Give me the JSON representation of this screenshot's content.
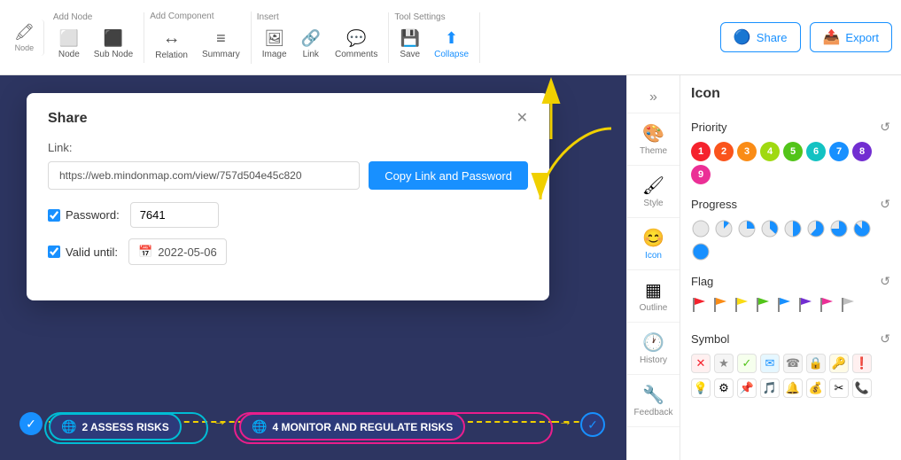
{
  "toolbar": {
    "groups": [
      {
        "label": "Add Node",
        "items": [
          {
            "id": "node",
            "icon": "⬜",
            "label": "Node"
          },
          {
            "id": "subnode",
            "icon": "⬛",
            "label": "Sub Node"
          }
        ]
      },
      {
        "label": "Add Component",
        "items": [
          {
            "id": "relation",
            "icon": "↔",
            "label": "Relation"
          },
          {
            "id": "summary",
            "icon": "📋",
            "label": "Summary"
          }
        ]
      },
      {
        "label": "Insert",
        "items": [
          {
            "id": "image",
            "icon": "🖼",
            "label": "Image"
          },
          {
            "id": "link",
            "icon": "🔗",
            "label": "Link"
          },
          {
            "id": "comments",
            "icon": "💬",
            "label": "Comments"
          }
        ]
      },
      {
        "label": "Tool Settings",
        "items": [
          {
            "id": "save",
            "icon": "💾",
            "label": "Save"
          },
          {
            "id": "collapse",
            "icon": "⬆",
            "label": "Collapse",
            "active": true
          }
        ]
      }
    ],
    "share_label": "Share",
    "export_label": "Export"
  },
  "share_dialog": {
    "title": "Share",
    "link_label": "Link:",
    "link_value": "https://web.mindonmap.com/view/757d504e45c820",
    "copy_button_label": "Copy Link and Password",
    "password_checked": true,
    "password_label": "Password:",
    "password_value": "7641",
    "valid_until_checked": true,
    "valid_until_label": "Valid until:",
    "valid_until_value": "2022-05-06"
  },
  "sidebar": {
    "items": [
      {
        "id": "theme",
        "icon": "🎨",
        "label": "Theme"
      },
      {
        "id": "style",
        "icon": "🖌",
        "label": "Style"
      },
      {
        "id": "icon",
        "icon": "😊",
        "label": "Icon",
        "active": true
      },
      {
        "id": "outline",
        "icon": "▦",
        "label": "Outline"
      },
      {
        "id": "history",
        "icon": "🕐",
        "label": "History"
      },
      {
        "id": "feedback",
        "icon": "🔧",
        "label": "Feedback"
      }
    ]
  },
  "right_panel": {
    "title": "Icon",
    "sections": {
      "priority": {
        "label": "Priority",
        "items": [
          {
            "num": "1",
            "color": "#f5222d"
          },
          {
            "num": "2",
            "color": "#fa541c"
          },
          {
            "num": "3",
            "color": "#fa8c16"
          },
          {
            "num": "4",
            "color": "#a0d911"
          },
          {
            "num": "5",
            "color": "#52c41a"
          },
          {
            "num": "6",
            "color": "#13c2c2"
          },
          {
            "num": "7",
            "color": "#1890ff"
          },
          {
            "num": "8",
            "color": "#722ed1"
          },
          {
            "num": "9",
            "color": "#eb2f96"
          }
        ]
      },
      "progress": {
        "label": "Progress",
        "items": [
          0,
          12,
          25,
          37,
          50,
          62,
          75,
          87,
          100
        ]
      },
      "flag": {
        "label": "Flag",
        "items": [
          {
            "color": "#f5222d"
          },
          {
            "color": "#fa8c16"
          },
          {
            "color": "#fadb14"
          },
          {
            "color": "#52c41a"
          },
          {
            "color": "#1890ff"
          },
          {
            "color": "#722ed1"
          },
          {
            "color": "#eb2f96"
          },
          {
            "color": "#bfbfbf"
          }
        ]
      },
      "symbol": {
        "label": "Symbol",
        "row1": [
          "✕",
          "✩",
          "✓",
          "✉",
          "☎",
          "🔒",
          "🔑",
          "!"
        ],
        "row2": [
          "💡",
          "⚙",
          "📌",
          "🎵",
          "🔔",
          "💰",
          "✂",
          "📞"
        ]
      }
    }
  },
  "canvas": {
    "nodes": [
      {
        "id": "assess",
        "label": "2 ASSESS RISKS",
        "icon": "🌐",
        "num": "2"
      },
      {
        "id": "monitor",
        "label": "4 MONITOR AND REGULATE RISKS",
        "icon": "🌐",
        "num": "4"
      }
    ]
  }
}
